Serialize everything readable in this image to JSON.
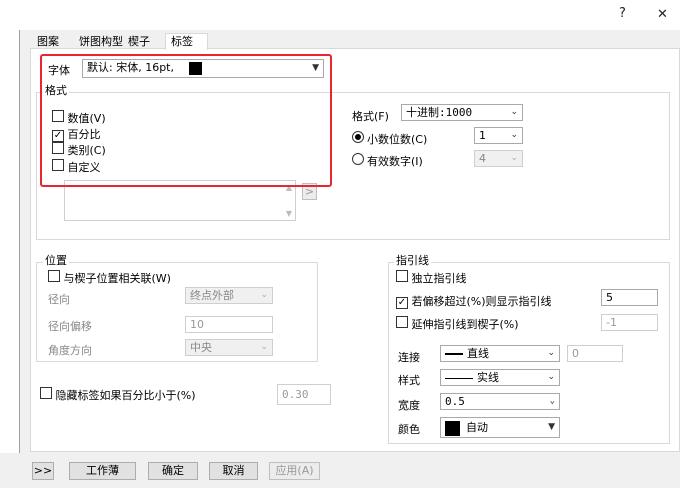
{
  "window": {
    "help": "?",
    "close": "✕"
  },
  "tabs": [
    "图案",
    "饼图构型",
    "楔子",
    "标签"
  ],
  "font": {
    "label": "字体",
    "value": "默认: 宋体, 16pt,",
    "swatch": "#000000"
  },
  "format_group": {
    "title": "格式",
    "checks": [
      {
        "label": "数值(V)",
        "checked": false
      },
      {
        "label": "百分比",
        "checked": true
      },
      {
        "label": "类别(C)",
        "checked": false
      },
      {
        "label": "自定义",
        "checked": false
      }
    ]
  },
  "format_right": {
    "format_label": "格式(F)",
    "format_value": "十进制:1000",
    "decimal_label": "小数位数(C)",
    "decimal_value": "1",
    "sig_label": "有效数字(I)",
    "sig_value": "4"
  },
  "custom_button": ">",
  "position": {
    "title": "位置",
    "assoc_label": "与楔子位置相关联(W)",
    "radial_label": "径向",
    "radial_value": "终点外部",
    "offset_label": "径向偏移",
    "offset_value": "10",
    "angle_label": "角度方向",
    "angle_value": "中央"
  },
  "hide": {
    "label": "隐藏标签如果百分比小于(%)",
    "value": "0.30"
  },
  "leader": {
    "title": "指引线",
    "independent_label": "独立指引线",
    "offset_label": "若偏移超过(%)则显示指引线",
    "offset_value": "5",
    "extend_label": "延伸指引线到楔子(%)",
    "extend_value": "-1",
    "connect_label": "连接",
    "connect_value": "直线",
    "connect_extra": "0",
    "style_label": "样式",
    "style_value": "实线",
    "width_label": "宽度",
    "width_value": "0.5",
    "color_label": "颜色",
    "color_value": "自动",
    "color_swatch": "#000000"
  },
  "buttons": {
    "expand": ">>",
    "workbook": "工作薄",
    "ok": "确定",
    "cancel": "取消",
    "apply": "应用(A)"
  },
  "colors": {
    "highlight": "#e8262b",
    "window_bg": "#f0f0f0",
    "panel_bg": "#ffffff"
  }
}
